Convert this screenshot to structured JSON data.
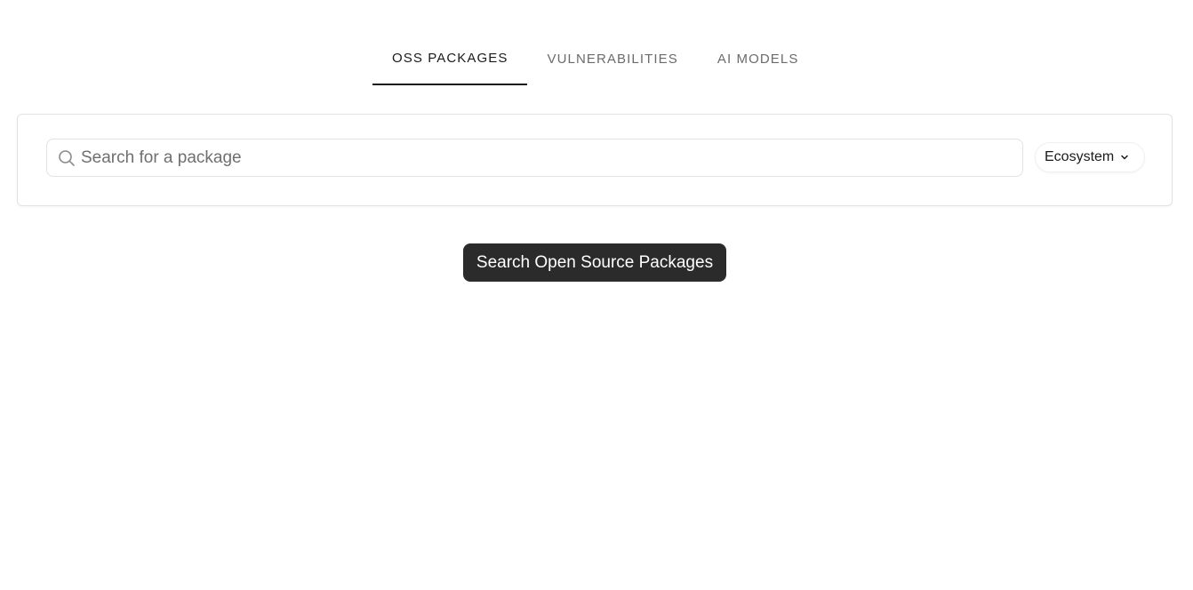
{
  "tabs": [
    {
      "label": "OSS PACKAGES",
      "active": true
    },
    {
      "label": "VULNERABILITIES",
      "active": false
    },
    {
      "label": "AI MODELS",
      "active": false
    }
  ],
  "search": {
    "placeholder": "Search for a package",
    "value": "",
    "icon": "search-icon"
  },
  "ecosystem": {
    "label": "Ecosystem",
    "icon": "chevron-down-icon"
  },
  "primary_button": {
    "label": "Search Open Source Packages"
  },
  "colors": {
    "accent": "#1a1a1a",
    "button_bg": "#2b2b2b",
    "border": "#e2e2e2",
    "muted_text": "#6b6b6b"
  }
}
